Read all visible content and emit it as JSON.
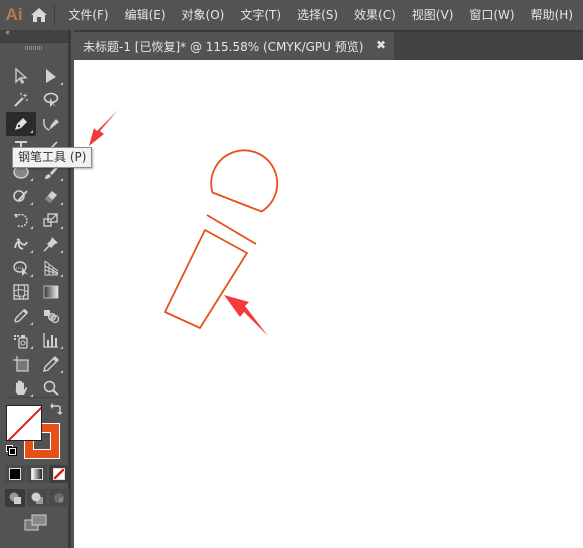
{
  "app": {
    "logo": "Ai",
    "home_icon": "home-icon"
  },
  "menu": {
    "items": [
      {
        "label": "文件(F)"
      },
      {
        "label": "编辑(E)"
      },
      {
        "label": "对象(O)"
      },
      {
        "label": "文字(T)"
      },
      {
        "label": "选择(S)"
      },
      {
        "label": "效果(C)"
      },
      {
        "label": "视图(V)"
      },
      {
        "label": "窗口(W)"
      },
      {
        "label": "帮助(H)"
      }
    ]
  },
  "toolbar": {
    "collapse_label": "‹‹",
    "tooltip": "钢笔工具 (P)",
    "active_tool": "pen-tool",
    "tools": [
      [
        "selection-tool",
        "direct-selection-tool"
      ],
      [
        "magic-wand-tool",
        "lasso-tool"
      ],
      [
        "pen-tool",
        "curvature-tool"
      ],
      [
        "type-tool",
        "line-segment-tool"
      ],
      [
        "ellipse-tool",
        "paintbrush-tool"
      ],
      [
        "shaper-tool",
        "eraser-tool"
      ],
      [
        "rotate-tool",
        "scale-tool"
      ],
      [
        "puppet-warp-tool",
        "pin-tool"
      ],
      [
        "shape-builder-tool",
        "perspective-grid-tool"
      ],
      [
        "mesh-tool",
        "gradient-tool"
      ],
      [
        "eyedropper-tool",
        "blend-tool"
      ],
      [
        "symbol-sprayer-tool",
        "column-graph-tool"
      ],
      [
        "artboard-tool",
        "slice-tool"
      ],
      [
        "hand-tool",
        "zoom-tool"
      ]
    ],
    "fill": {
      "state": "none"
    },
    "stroke": {
      "color": "#E8501A"
    },
    "color_modes": [
      "color",
      "gradient",
      "none"
    ],
    "draw_modes": [
      "draw-normal",
      "draw-behind",
      "draw-inside"
    ]
  },
  "document": {
    "tab_title": "未标题-1 [已恢复]* @ 115.58% (CMYK/GPU 预览)",
    "close_label": "✖"
  },
  "artwork": {
    "stroke_color": "#E8501A",
    "subject": "microphone outline",
    "annotation_color": "#F03C3C"
  }
}
